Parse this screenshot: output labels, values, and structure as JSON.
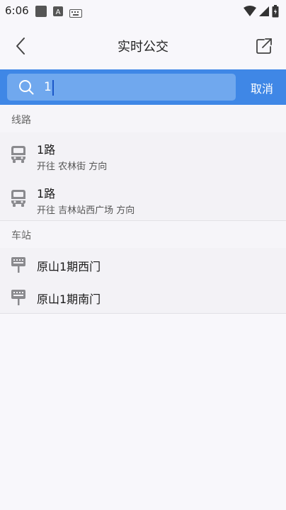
{
  "status_bar": {
    "time": "6:06"
  },
  "header": {
    "title": "实时公交"
  },
  "search": {
    "value": "1",
    "cancel_label": "取消"
  },
  "routes_section": {
    "header": "线路",
    "items": [
      {
        "name": "1路",
        "direction": "开往 农林街 方向"
      },
      {
        "name": "1路",
        "direction": "开往 吉林站西广场 方向"
      }
    ]
  },
  "stations_section": {
    "header": "车站",
    "items": [
      {
        "name": "原山1期西门"
      },
      {
        "name": "原山1期南门"
      }
    ]
  },
  "colors": {
    "accent": "#3f87e6",
    "search_box": "#70a8ee",
    "icon_gray": "#8a8a8e",
    "background": "#f8f7fb"
  }
}
